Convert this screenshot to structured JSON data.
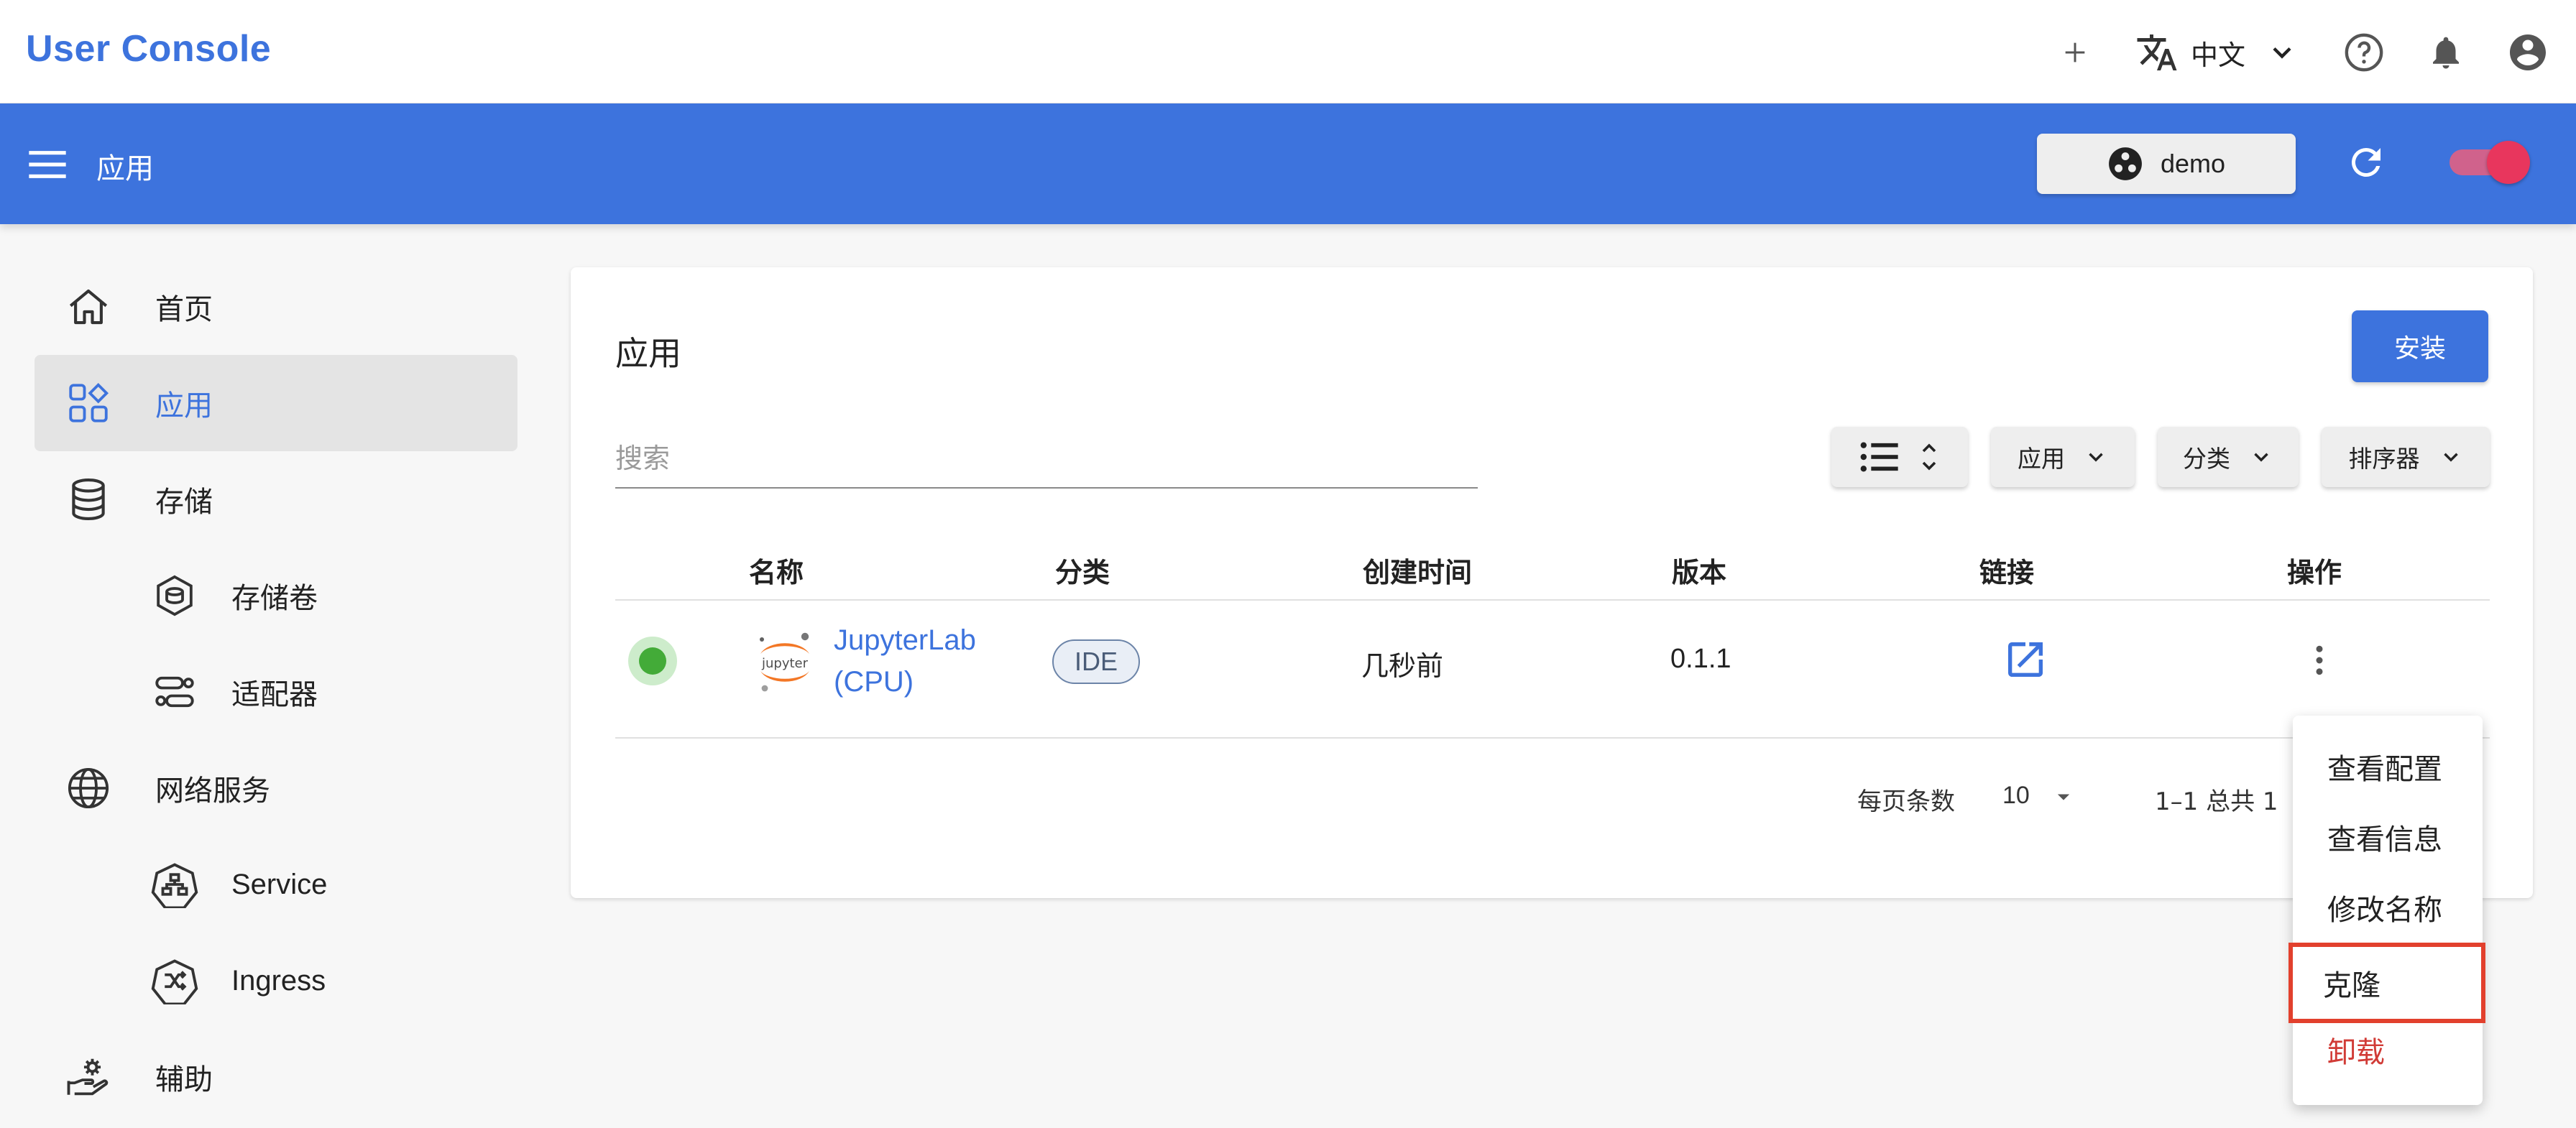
{
  "app": {
    "brand": "User Console"
  },
  "header": {
    "language_label": "中文",
    "icons": [
      "add-icon",
      "translate-icon",
      "chevron-down-icon",
      "help-icon",
      "bell-icon",
      "account-icon"
    ]
  },
  "toolbar": {
    "title": "应用",
    "namespace_label": "demo",
    "accent_color": "#3d73dd",
    "toggle_on": true
  },
  "sidebar": {
    "items": [
      {
        "label": "首页",
        "icon": "home-icon"
      },
      {
        "label": "应用",
        "icon": "apps-grid-icon",
        "active": true
      },
      {
        "label": "存储",
        "icon": "database-icon"
      },
      {
        "label": "存储卷",
        "icon": "volume-icon"
      },
      {
        "label": "适配器",
        "icon": "adapter-icon"
      },
      {
        "label": "网络服务",
        "icon": "globe-icon"
      },
      {
        "label": "Service",
        "icon": "service-icon"
      },
      {
        "label": "Ingress",
        "icon": "ingress-icon"
      },
      {
        "label": "辅助",
        "icon": "helper-icon"
      }
    ]
  },
  "main": {
    "title": "应用",
    "install_label": "安装",
    "search_placeholder": "搜索",
    "filters": {
      "app": "应用",
      "category": "分类",
      "sorter": "排序器"
    },
    "table": {
      "headers": [
        "名称",
        "分类",
        "创建时间",
        "版本",
        "链接",
        "操作"
      ],
      "rows": [
        {
          "status": "running",
          "logo_text": "jupyter",
          "name": "JupyterLab (CPU)",
          "category": "IDE",
          "created": "几秒前",
          "version": "0.1.1"
        }
      ]
    },
    "pagination": {
      "rows_per_page_label": "每页条数",
      "rows_per_page": "10",
      "range": "1–1 总共 1"
    }
  },
  "context_menu": {
    "items": [
      {
        "label": "查看配置"
      },
      {
        "label": "查看信息"
      },
      {
        "label": "修改名称"
      },
      {
        "label": "克隆",
        "highlighted": true
      },
      {
        "label": "卸载",
        "danger": true
      }
    ],
    "highlight_color": "#e2402d",
    "danger_color": "#d13b36"
  }
}
